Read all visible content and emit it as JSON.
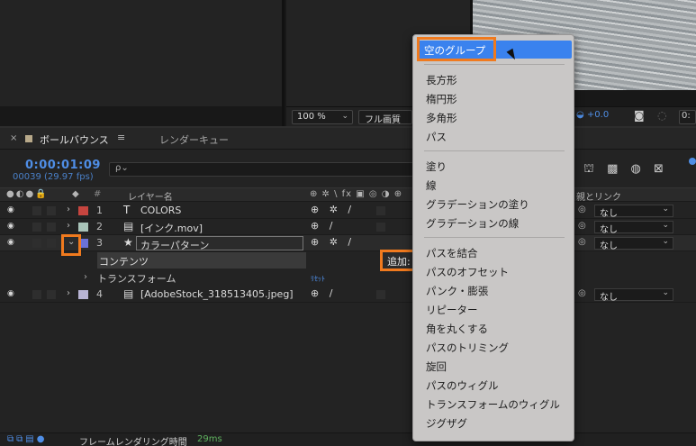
{
  "viewer": {
    "zoom": "100 %",
    "resolution": "フル画質",
    "exposure": "+0.0"
  },
  "timeline": {
    "tab_comp": "ボールバウンス",
    "tab_render": "レンダーキュー",
    "timecode": "0:00:01:09",
    "frames": "00039 (29.97 fps)",
    "search_glyph": "ρ⌄",
    "headers": {
      "num": "#",
      "name": "レイヤー名",
      "switches": "⊕ ✲ \\ fx ▣ ◎ ◑ ⊕",
      "parent": "親とリンク"
    },
    "layers": [
      {
        "num": "1",
        "type": "T",
        "name": "COLORS",
        "color": "#c6453f",
        "parent": "なし",
        "switches": "⊕ ✲ /"
      },
      {
        "num": "2",
        "type": "▤",
        "name": "[インク.mov]",
        "color": "#a9c4b9",
        "parent": "なし",
        "switches": "⊕ /"
      },
      {
        "num": "3",
        "type": "★",
        "name": "カラーパターン",
        "color": "#6b72d8",
        "parent": "なし",
        "switches": "⊕ ✲ /"
      },
      {
        "num": "4",
        "type": "▤",
        "name": "[AdobeStock_318513405.jpeg]",
        "color": "#b8b4d4",
        "parent": "なし",
        "switches": "⊕ /"
      }
    ],
    "sub_contents": "コンテンツ",
    "sub_transform": "トランスフォーム",
    "reset": "ﾘｾｯﾄ",
    "add_button": "追加:"
  },
  "status": {
    "label": "フレームレンダリング時間",
    "value": "29ms"
  },
  "context_menu": {
    "items": [
      {
        "label": "空のグループ",
        "highlighted": true
      },
      {
        "label": "長方形"
      },
      {
        "label": "楕円形"
      },
      {
        "label": "多角形"
      },
      {
        "label": "パス"
      },
      {
        "label": "塗り"
      },
      {
        "label": "線"
      },
      {
        "label": "グラデーションの塗り"
      },
      {
        "label": "グラデーションの線"
      },
      {
        "label": "パスを結合"
      },
      {
        "label": "パスのオフセット"
      },
      {
        "label": "パンク・膨張"
      },
      {
        "label": "リピーター"
      },
      {
        "label": "角を丸くする"
      },
      {
        "label": "パスのトリミング"
      },
      {
        "label": "旋回"
      },
      {
        "label": "パスのウィグル"
      },
      {
        "label": "トランスフォームのウィグル"
      },
      {
        "label": "ジグザグ"
      }
    ]
  },
  "colors": {
    "accent_blue": "#4f8ee6",
    "highlight_orange": "#f07a1e",
    "menu_highlight": "#3a82ee"
  }
}
